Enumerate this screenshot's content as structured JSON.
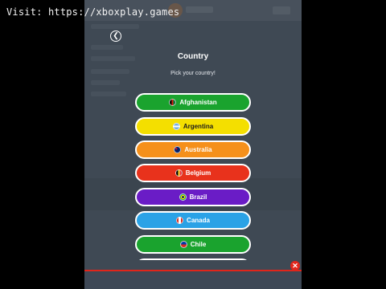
{
  "watermark": "Visit: https://xboxplay.games",
  "dialog": {
    "back_icon": "chevron-left-icon",
    "title": "Country",
    "subtitle": "Pick your country!"
  },
  "countries": [
    {
      "label": "Afghanistan",
      "color": "#1aa32e",
      "text_color": "#ffffff",
      "flag_icon": "afghanistan-flag-icon"
    },
    {
      "label": "Argentina",
      "color": "#f4df00",
      "text_color": "#1b1b1b",
      "flag_icon": "argentina-flag-icon"
    },
    {
      "label": "Australia",
      "color": "#f5901b",
      "text_color": "#ffffff",
      "flag_icon": "australia-flag-icon"
    },
    {
      "label": "Belgium",
      "color": "#e8321c",
      "text_color": "#ffffff",
      "flag_icon": "belgium-flag-icon"
    },
    {
      "label": "Brazil",
      "color": "#6a1cc6",
      "text_color": "#ffffff",
      "flag_icon": "brazil-flag-icon"
    },
    {
      "label": "Canada",
      "color": "#2aa2e6",
      "text_color": "#ffffff",
      "flag_icon": "canada-flag-icon"
    },
    {
      "label": "Chile",
      "color": "#1aa32e",
      "text_color": "#ffffff",
      "flag_icon": "chile-flag-icon"
    }
  ],
  "close_icon": "close-icon",
  "accent_red": "#e1251b"
}
